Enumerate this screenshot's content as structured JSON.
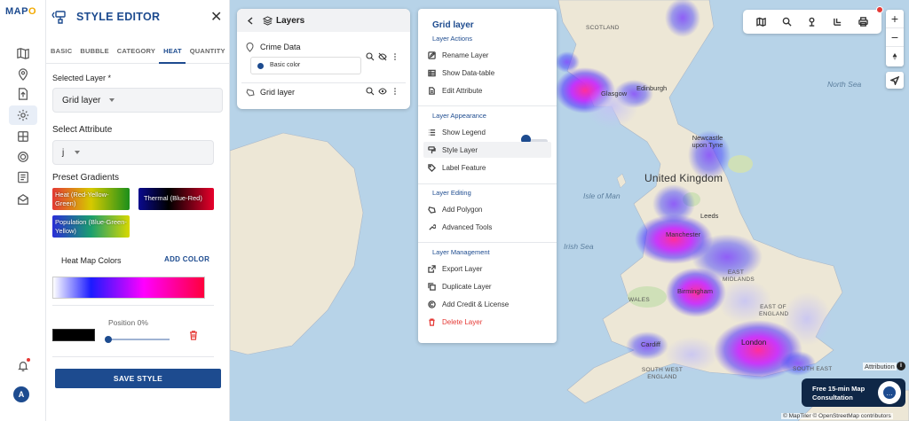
{
  "app": {
    "logo_main": "MAP",
    "logo_accent": "O"
  },
  "rail": {
    "icons": [
      "map-icon",
      "pin-icon",
      "upload-icon",
      "settings-icon",
      "layers-icon",
      "gear-icon",
      "list-icon",
      "share-icon",
      "bell-icon"
    ],
    "avatar_initial": "A"
  },
  "editor": {
    "title": "STYLE EDITOR",
    "tabs": [
      {
        "label": "BASIC"
      },
      {
        "label": "BUBBLE"
      },
      {
        "label": "CATEGORY"
      },
      {
        "label": "HEAT",
        "active": true
      },
      {
        "label": "QUANTITY"
      }
    ],
    "selected_layer_label": "Selected Layer *",
    "selected_layer_value": "Grid layer",
    "select_attribute_label": "Select Attribute",
    "select_attribute_value": "j",
    "preset_label": "Preset Gradients",
    "presets": [
      {
        "label": "Heat (Red-Yellow-Green)"
      },
      {
        "label": "Thermal (Blue-Red)"
      },
      {
        "label": "Population (Blue-Green-Yellow)"
      }
    ],
    "heatmap_colors_label": "Heat Map Colors",
    "add_color_label": "ADD COLOR",
    "position_label": "Position 0%",
    "position_value": 0,
    "swatch_color": "#000000",
    "save_label": "SAVE STYLE"
  },
  "layers": {
    "title": "Layers",
    "items": [
      {
        "name": "Crime Data",
        "style_label": "Basic color"
      },
      {
        "name": "Grid layer"
      }
    ]
  },
  "context_menu": {
    "title": "Grid layer",
    "sections": {
      "actions": "Layer Actions",
      "appearance": "Layer Appearance",
      "editing": "Layer Editing",
      "management": "Layer Management"
    },
    "items": {
      "rename": "Rename Layer",
      "datatable": "Show Data-table",
      "edit_attr": "Edit Attribute",
      "legend": "Show Legend",
      "style": "Style Layer",
      "label": "Label Feature",
      "add_polygon": "Add Polygon",
      "advanced": "Advanced Tools",
      "export": "Export Layer",
      "duplicate": "Duplicate Layer",
      "credit": "Add Credit & License",
      "delete": "Delete Layer"
    },
    "legend_toggle_on": true
  },
  "map": {
    "places": {
      "scotland": "SCOTLAND",
      "glasgow": "Glasgow",
      "edinburgh": "Edinburgh",
      "north_sea": "North Sea",
      "newcastle": "Newcastle upon Tyne",
      "uk": "United Kingdom",
      "isle_of_man": "Isle of Man",
      "leeds": "Leeds",
      "manchester": "Manchester",
      "irish_sea": "Irish Sea",
      "east_midlands": "EAST MIDLANDS",
      "birmingham": "Birmingham",
      "wales": "WALES",
      "east_of_england": "EAST OF ENGLAND",
      "cardiff": "Cardiff",
      "london": "London",
      "south_west": "SOUTH WEST ENGLAND",
      "south_east": "SOUTH EAST"
    },
    "attribution": "© MapTiler © OpenStreetMap contributors",
    "attribution_label": "Attribution",
    "consult": "Free 15-min Map Consultation"
  },
  "colors": {
    "brand": "#1d4b8f",
    "accent": "#f2a900",
    "danger": "#e53935"
  }
}
